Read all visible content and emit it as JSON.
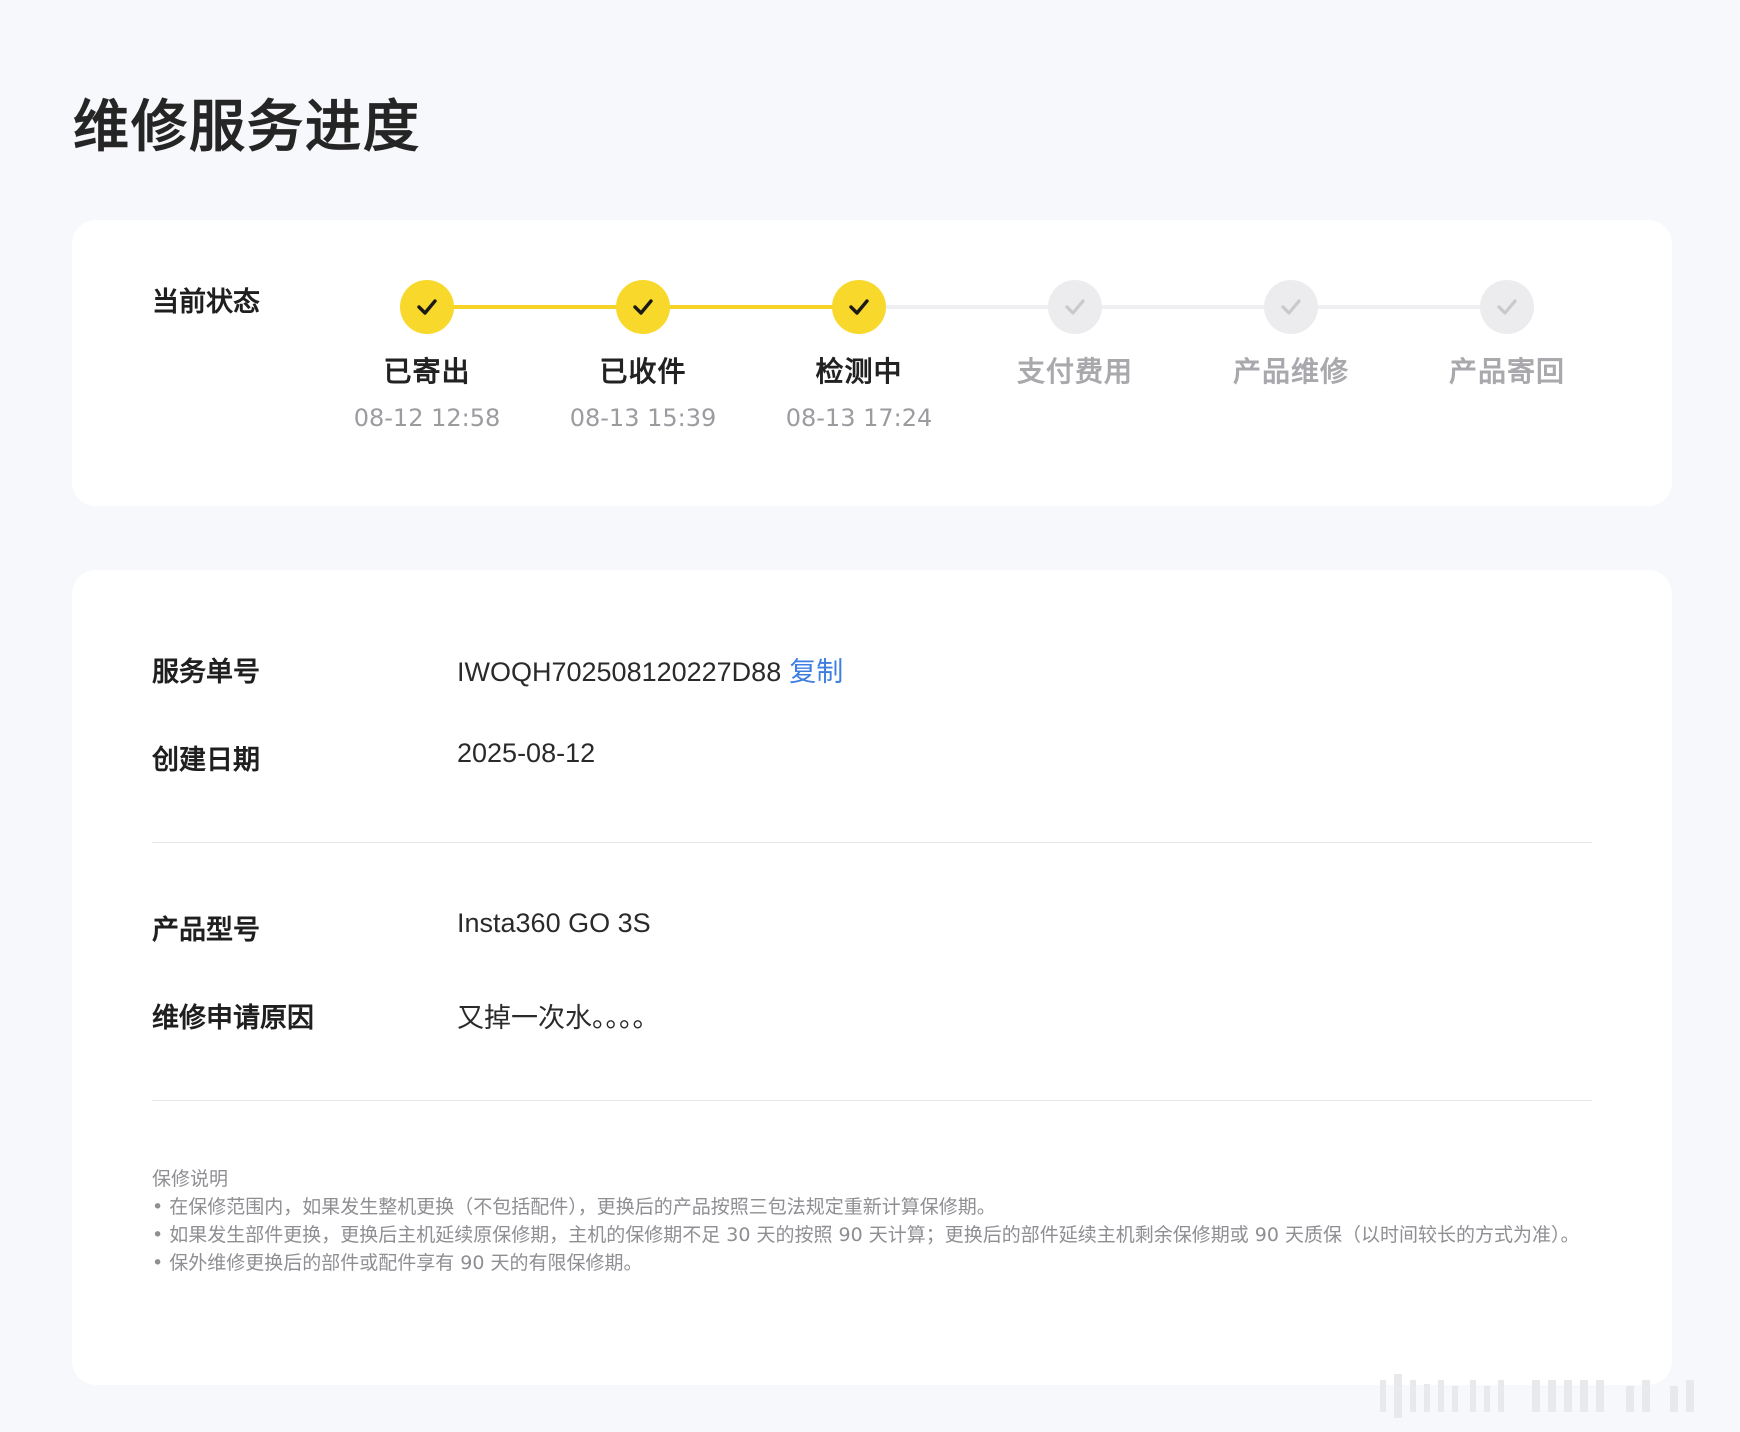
{
  "page": {
    "title": "维修服务进度"
  },
  "status": {
    "label": "当前状态",
    "steps": [
      {
        "name": "已寄出",
        "time": "08-12 12:58",
        "done": true
      },
      {
        "name": "已收件",
        "time": "08-13 15:39",
        "done": true
      },
      {
        "name": "检测中",
        "time": "08-13 17:24",
        "done": true
      },
      {
        "name": "支付费用",
        "time": "",
        "done": false
      },
      {
        "name": "产品维修",
        "time": "",
        "done": false
      },
      {
        "name": "产品寄回",
        "time": "",
        "done": false
      }
    ],
    "colors": {
      "done": "#f7d82b",
      "todo": "#ececee"
    }
  },
  "details": {
    "service_number": {
      "label": "服务单号",
      "value": "IWOQH702508120227D88",
      "copy_label": "复制"
    },
    "created_date": {
      "label": "创建日期",
      "value": "2025-08-12"
    },
    "product_model": {
      "label": "产品型号",
      "value": "Insta360 GO 3S"
    },
    "repair_reason": {
      "label": "维修申请原因",
      "value": "又掉一次水。。。。"
    }
  },
  "warranty": {
    "title": "保修说明",
    "items": [
      "• 在保修范围内，如果发生整机更换（不包括配件），更换后的产品按照三包法规定重新计算保修期。",
      "• 如果发生部件更换，更换后主机延续原保修期，主机的保修期不足 30 天的按照 90 天计算；更换后的部件延续主机剩余保修期或 90 天质保（以时间较长的方式为准）。",
      "• 保外维修更换后的部件或配件享有 90 天的有限保修期。"
    ]
  },
  "accent": {
    "link": "#3d7fe0"
  }
}
